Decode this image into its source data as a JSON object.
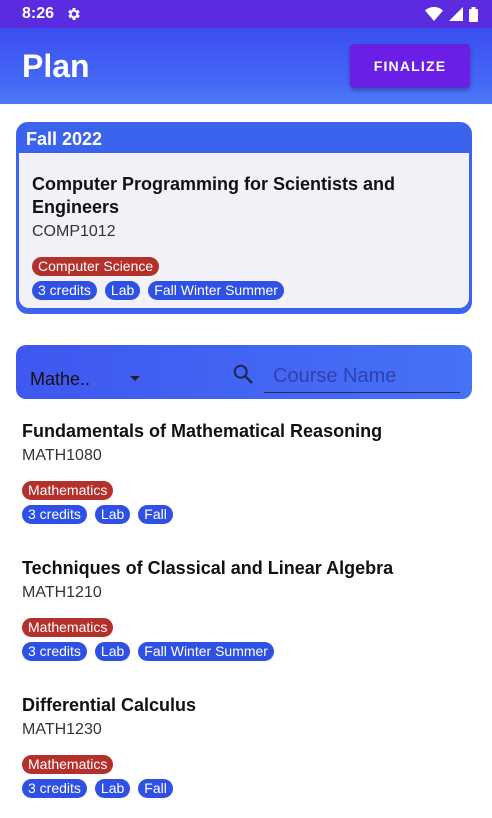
{
  "status_bar": {
    "time": "8:26",
    "icons": [
      "gear-icon",
      "wifi-icon",
      "signal-icon",
      "battery-icon"
    ]
  },
  "app_bar": {
    "title": "Plan",
    "finalize_label": "FINALIZE"
  },
  "semester": {
    "label": "Fall 2022",
    "course": {
      "title": "Computer Programming for Scientists and Engineers",
      "code": "COMP1012",
      "department": "Computer Science",
      "credits": "3 credits",
      "lab": "Lab",
      "terms": "Fall Winter Summer"
    }
  },
  "filter": {
    "department_value": "Mathe..",
    "search_placeholder": "Course Name"
  },
  "courses": [
    {
      "title": "Fundamentals of Mathematical Reasoning",
      "code": "MATH1080",
      "department": "Mathematics",
      "credits": "3 credits",
      "lab": "Lab",
      "terms": "Fall"
    },
    {
      "title": "Techniques of Classical and Linear Algebra",
      "code": "MATH1210",
      "department": "Mathematics",
      "credits": "3 credits",
      "lab": "Lab",
      "terms": "Fall Winter Summer"
    },
    {
      "title": "Differential Calculus",
      "code": "MATH1230",
      "department": "Mathematics",
      "credits": "3 credits",
      "lab": "Lab",
      "terms": "Fall"
    }
  ],
  "colors": {
    "status_bar": "#5b2be0",
    "primary": "#3c63ee",
    "finalize": "#6b1fe6",
    "department_tag": "#b3302b",
    "info_tag": "#2f50e4"
  }
}
